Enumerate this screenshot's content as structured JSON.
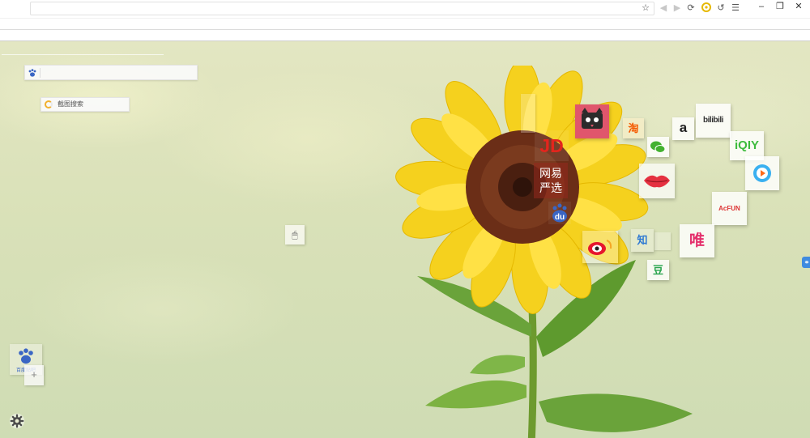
{
  "browser": {
    "address_bar": {
      "value": "",
      "bookmark_icon": "star-icon"
    },
    "toolbar_icons": [
      "refresh-icon",
      "extension-icon",
      "undo-icon",
      "menu-icon"
    ],
    "window_controls": {
      "minimize": "–",
      "restore": "❐",
      "close": "✕"
    }
  },
  "search": {
    "placeholder": "",
    "engine_icon": "baidu-paw-icon"
  },
  "image_search": {
    "label": "截图搜索"
  },
  "tiles": {
    "jd": "JD",
    "wangyi_line1": "网易",
    "wangyi_line2": "严选",
    "taobao": "淘",
    "amazon": "a",
    "bilibili": "bilibili",
    "iqiyi": "iQIY",
    "du": "du",
    "acfun": "AcFUN",
    "zhihu": "知",
    "vip": "唯",
    "douban": "豆"
  },
  "baidu_widget": {
    "label": "百度贴吧"
  },
  "plus_widget": {
    "label": "+"
  },
  "colors": {
    "wallpaper": "#dde2bd",
    "jd_red": "#e3251d",
    "tmall_pink": "#e0566c",
    "iqiyi_green": "#3dbb3d",
    "bili_text": "#333333",
    "baidu_blue": "#3a66c4"
  }
}
